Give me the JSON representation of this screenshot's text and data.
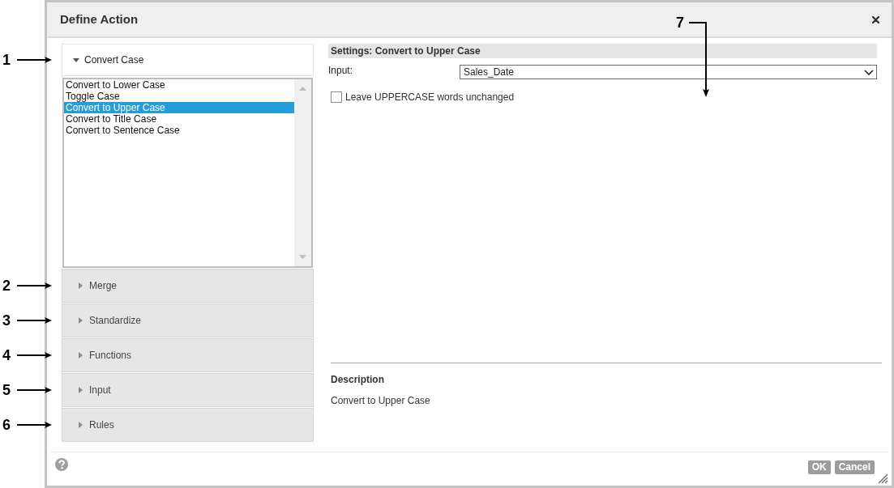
{
  "dialog": {
    "title": "Define Action"
  },
  "sections": [
    {
      "title": "Convert Case",
      "expanded": true,
      "callout": "1",
      "items": [
        {
          "label": "Convert to Lower Case",
          "selected": false
        },
        {
          "label": "Toggle Case",
          "selected": false
        },
        {
          "label": "Convert to Upper Case",
          "selected": true
        },
        {
          "label": "Convert to Title Case",
          "selected": false
        },
        {
          "label": "Convert to Sentence Case",
          "selected": false
        }
      ]
    },
    {
      "title": "Merge",
      "expanded": false,
      "callout": "2"
    },
    {
      "title": "Standardize",
      "expanded": false,
      "callout": "3"
    },
    {
      "title": "Functions",
      "expanded": false,
      "callout": "4"
    },
    {
      "title": "Input",
      "expanded": false,
      "callout": "5"
    },
    {
      "title": "Rules",
      "expanded": false,
      "callout": "6"
    }
  ],
  "settings": {
    "title": "Settings: Convert to Upper Case",
    "callout": "7",
    "input": {
      "label": "Input:",
      "value": "Sales_Date"
    },
    "option": {
      "label": "Leave UPPERCASE words unchanged",
      "checked": false
    }
  },
  "description": {
    "title": "Description",
    "text": "Convert to Upper Case"
  },
  "buttons": [
    {
      "label": "OK"
    },
    {
      "label": "Cancel"
    }
  ]
}
